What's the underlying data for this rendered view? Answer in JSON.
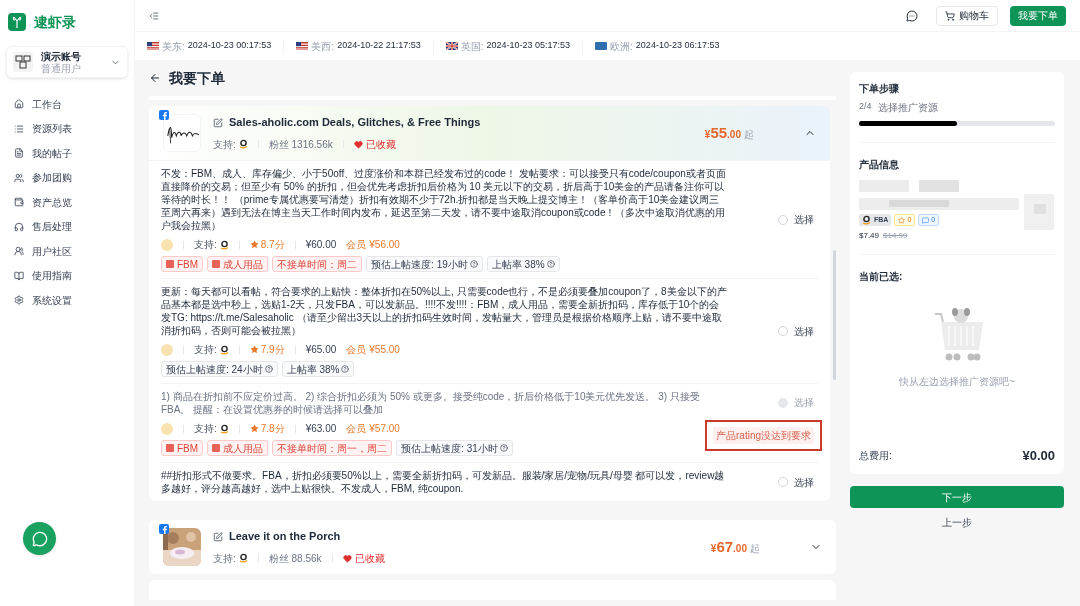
{
  "app": {
    "name": "逮虾录"
  },
  "account": {
    "name": "演示账号",
    "role": "普通用户"
  },
  "nav": [
    {
      "label": "工作台"
    },
    {
      "label": "资源列表"
    },
    {
      "label": "我的帖子"
    },
    {
      "label": "参加团购"
    },
    {
      "label": "资产总览"
    },
    {
      "label": "售后处理"
    },
    {
      "label": "用户社区"
    },
    {
      "label": "使用指南"
    },
    {
      "label": "系统设置"
    }
  ],
  "header": {
    "cart_label": "购物车",
    "order_label": "我要下单"
  },
  "timezones": [
    {
      "kind": "us",
      "region": "美东:",
      "time": "2024-10-23 00:17:53"
    },
    {
      "kind": "us",
      "region": "美西:",
      "time": "2024-10-22 21:17:53"
    },
    {
      "kind": "uk",
      "region": "英国:",
      "time": "2024-10-23 05:17:53"
    },
    {
      "kind": "eu",
      "region": "欧洲:",
      "time": "2024-10-23 06:17:53"
    }
  ],
  "page_title": "我要下单",
  "channels": [
    {
      "kind": "facebook",
      "name": "Sales-aholic.com Deals, Glitches, & Free Things",
      "support_label": "支持:",
      "followers": "粉丝 1316.56k",
      "favorited": true,
      "favorite_label": "已收藏",
      "price_currency": "¥",
      "price_int": "55",
      "price_dec": ".00",
      "price_suffix": "起",
      "expanded": true,
      "offers": [
        {
          "description": "不发：FBM、成人、库存偏少、小于50off、过度涨价和本群已经发布过的code！ 发帖要求：可以接受只有code/coupon或者页面直接降价的交易；但至少有 50% 的折扣，但会优先考虑折扣后价格为 10 美元以下的交易，折后高于10美金的产品请备注你可以等待的时长！！ （prime专属优惠要写清楚）折扣有效期不少于72h.折扣都是当天晚上提交博主！（客单价高于10美金建议周三至周六再来）遇到无法在博主当天工作时间内发布，延迟至第二天发，请不要中途取消coupon或code！（多次中途取消优惠的用户我会拉黑）",
          "support_label": "支持:",
          "rating": "8.7分",
          "price": "¥60.00",
          "member_label": "会员",
          "member_price": "¥56.00",
          "tags": [
            {
              "kind": "icon-red",
              "text": "FBM"
            },
            {
              "kind": "icon-red",
              "text": "成人用品"
            },
            {
              "kind": "red",
              "text": "不接单时间：周二"
            },
            {
              "kind": "info",
              "text": "预估上帖速度: 19小时"
            },
            {
              "kind": "info",
              "text": "上帖率 38%"
            }
          ],
          "select_label": "选择",
          "checked": false,
          "disabled": false
        },
        {
          "description": "更新：每天都可以看帖，符合要求的上贴快：整体折扣在50%以上, 只需要code也行，不是必须要叠加coupon了，8美金以下的产品基本都是选中秒上，选贴1-2天，只发FBA，可以发新品。!!!!不发!!!!：FBM，成人用品，需要全新折扣码，库存低于10个的会发TG: https://t.me/Salesaholic （请至少留出3天以上的折扣码生效时间，发帖量大，管理员是根据价格顺序上贴，请不要中途取消折扣码，否则可能会被拉黑）",
          "support_label": "支持:",
          "rating": "7.9分",
          "price": "¥65.00",
          "member_label": "会员",
          "member_price": "¥55.00",
          "tags": [
            {
              "kind": "info",
              "text": "预估上帖速度: 24小时"
            },
            {
              "kind": "info",
              "text": "上帖率 38%"
            }
          ],
          "select_label": "选择",
          "checked": false,
          "disabled": false
        },
        {
          "description": "1) 商品在折扣前不应定价过高。 2) 综合折扣必须为 50% 或更多。接受纯code，折后价格低于10美元优先发送。 3) 只接受FBA。 提醒：在设置优惠券的时候请选择可以叠加",
          "support_label": "支持:",
          "rating": "7.8分",
          "price": "¥63.00",
          "member_label": "会员",
          "member_price": "¥57.00",
          "tags": [
            {
              "kind": "icon-red",
              "text": "FBM"
            },
            {
              "kind": "icon-red",
              "text": "成人用品"
            },
            {
              "kind": "red",
              "text": "不接单时间：周一，周二"
            },
            {
              "kind": "info",
              "text": "预估上帖速度: 31小时"
            }
          ],
          "select_label": "选择",
          "checked": false,
          "disabled": true,
          "reason": "产品rating没达到要求"
        },
        {
          "description": "##折扣形式不做要求。FBA，折扣必须要50%以上，需要全新折扣码，可发新品。服装/家居/宠物/玩具/母婴 都可以发，review越多越好，评分越高越好，选中上贴很快。不发成人，FBM, 纯coupon.",
          "select_label": "选择",
          "checked": false,
          "disabled": false
        }
      ]
    },
    {
      "kind": "facebook",
      "name": "Leave it on the Porch",
      "support_label": "支持:",
      "followers": "粉丝 88.56k",
      "favorited": true,
      "favorite_label": "已收藏",
      "price_currency": "¥",
      "price_int": "67",
      "price_dec": ".00",
      "price_suffix": "起",
      "expanded": false
    }
  ],
  "steps": {
    "title": "下单步骤",
    "count": "2/4",
    "current": "选择推广资源",
    "level": 0.5
  },
  "product": {
    "title": "产品信息",
    "fulfillment": "FBA",
    "stars": "0",
    "reviews": "0",
    "price": "$7.49",
    "original_price": "$14.99"
  },
  "selection": {
    "title": "当前已选:",
    "empty": "快从左边选择推广资源吧~",
    "total_label": "总费用:",
    "total": "¥0.00"
  },
  "actions": {
    "next": "下一步",
    "back": "上一步"
  }
}
